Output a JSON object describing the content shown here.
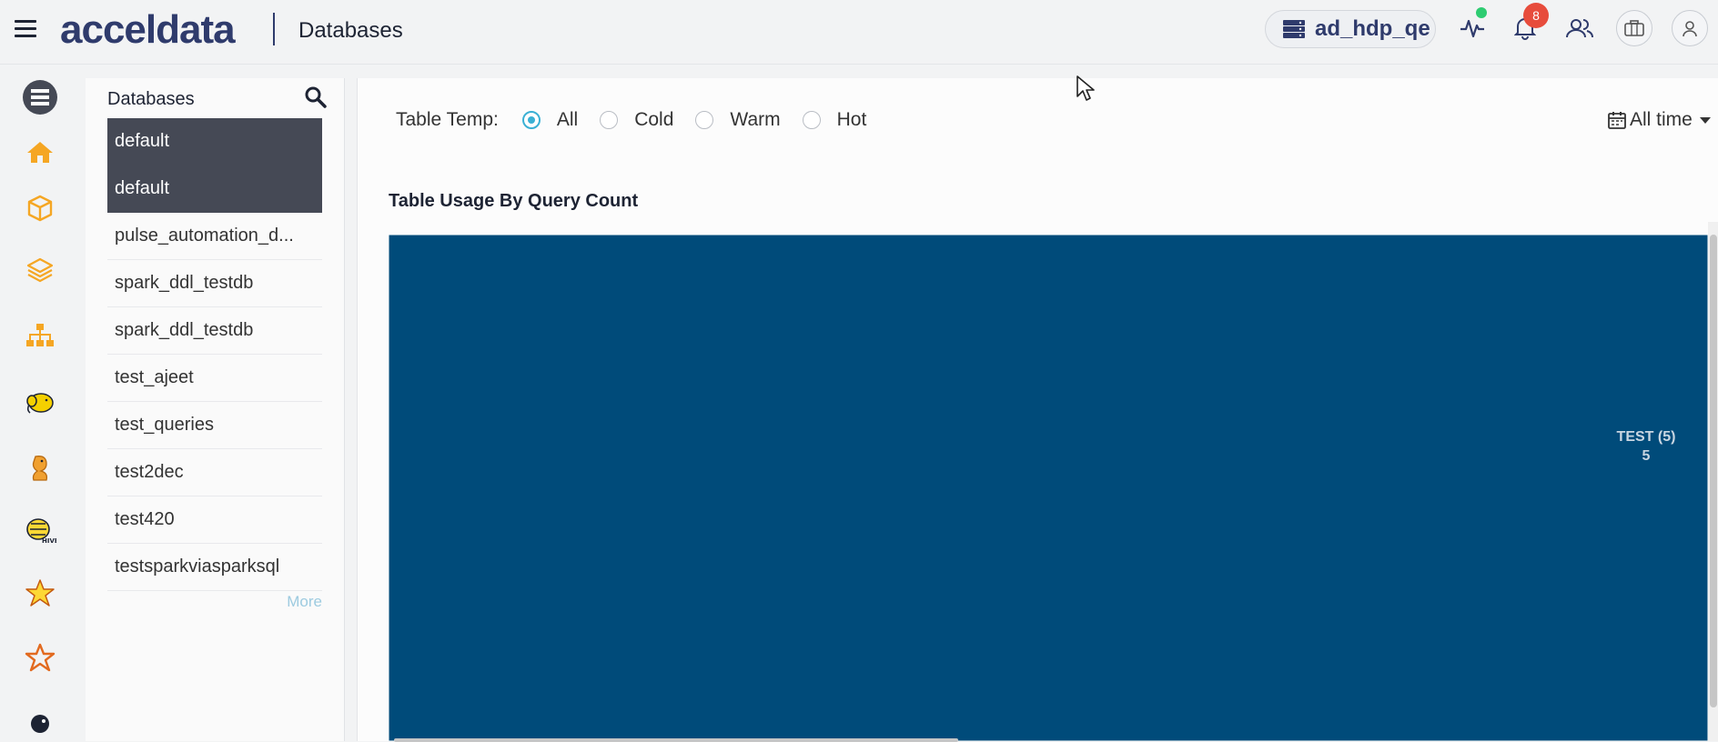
{
  "header": {
    "logo_text": "acceldata",
    "page_title": "Databases",
    "cluster_name": "ad_hdp_qe",
    "notification_count": "8",
    "icons": [
      "menu-icon",
      "server-icon",
      "activity-icon",
      "bell-icon",
      "users-icon",
      "briefcase-icon",
      "user-icon"
    ]
  },
  "rail": {
    "items": [
      "databases-icon",
      "home-icon",
      "cube-icon",
      "layers-icon",
      "sitemap-icon",
      "hadoop-icon",
      "hdfs-icon",
      "hive-icon",
      "impala-icon",
      "spark-icon",
      "kafka-icon"
    ]
  },
  "db_panel": {
    "title": "Databases",
    "items": [
      {
        "name": "default",
        "selected": true
      },
      {
        "name": "default",
        "selected": true
      },
      {
        "name": "pulse_automation_d...",
        "selected": false
      },
      {
        "name": "spark_ddl_testdb",
        "selected": false
      },
      {
        "name": "spark_ddl_testdb",
        "selected": false
      },
      {
        "name": "test_ajeet",
        "selected": false
      },
      {
        "name": "test_queries",
        "selected": false
      },
      {
        "name": "test2dec",
        "selected": false
      },
      {
        "name": "test420",
        "selected": false
      },
      {
        "name": "testsparkviasparksql",
        "selected": false
      }
    ],
    "more_label": "More"
  },
  "filters": {
    "label": "Table Temp:",
    "options": [
      {
        "label": "All",
        "checked": true
      },
      {
        "label": "Cold",
        "checked": false
      },
      {
        "label": "Warm",
        "checked": false
      },
      {
        "label": "Hot",
        "checked": false
      }
    ],
    "time_range": "All time"
  },
  "chart_title": "Table Usage By Query Count",
  "chart_data": {
    "type": "treemap",
    "title": "Table Usage By Query Count",
    "categories": [
      "TEST"
    ],
    "values": [
      5
    ],
    "labels": [
      "TEST (5)"
    ],
    "color": "#004b7a"
  },
  "colors": {
    "accent": "#3ab0d4",
    "brand": "#2f3b6c",
    "rail_icon": "#f5a623",
    "selected_row": "#454955",
    "badge": "#e74c3c"
  }
}
